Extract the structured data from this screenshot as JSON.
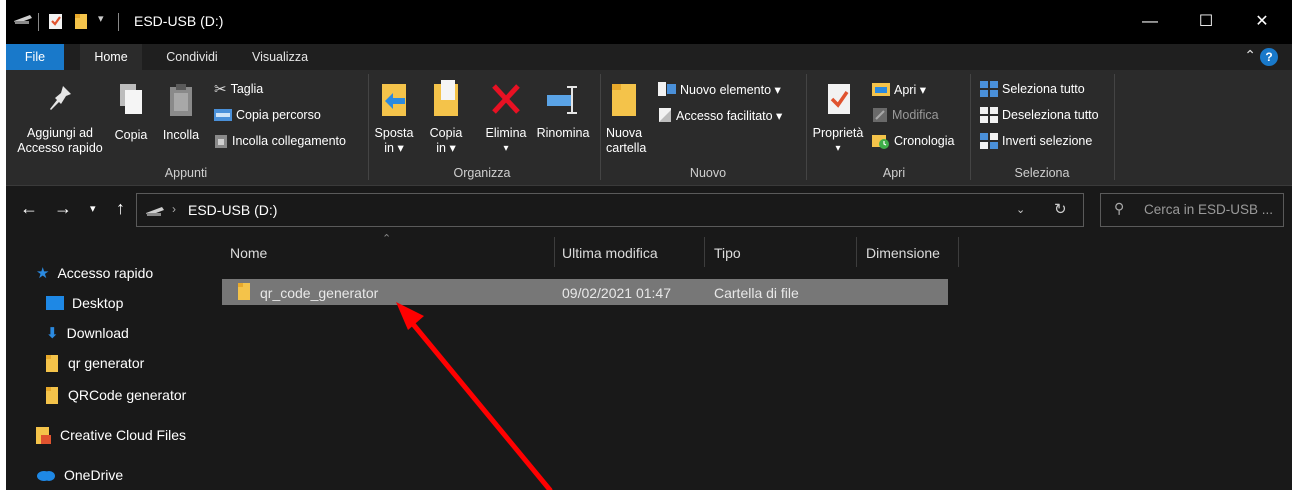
{
  "window": {
    "title": "ESD-USB (D:)",
    "controls": {
      "minimize": "—",
      "maximize": "☐",
      "close": "✕"
    }
  },
  "tabs": [
    {
      "label": "File"
    },
    {
      "label": "Home"
    },
    {
      "label": "Condividi"
    },
    {
      "label": "Visualizza"
    }
  ],
  "ribbon": {
    "appunti": {
      "label": "Appunti",
      "pin_label_1": "Aggiungi ad",
      "pin_label_2": "Accesso rapido",
      "copy": "Copia",
      "paste": "Incolla",
      "cut": "Taglia",
      "copy_path": "Copia percorso",
      "paste_shortcut": "Incolla collegamento"
    },
    "organizza": {
      "label": "Organizza",
      "move_1": "Sposta",
      "move_2": "in ▾",
      "copy_1": "Copia",
      "copy_2": "in ▾",
      "delete": "Elimina",
      "delete_2": "▾",
      "rename": "Rinomina"
    },
    "nuovo": {
      "label": "Nuovo",
      "new_folder_1": "Nuova",
      "new_folder_2": "cartella",
      "new_item": "Nuovo elemento ▾",
      "easy_access": "Accesso facilitato ▾"
    },
    "apri": {
      "label": "Apri",
      "properties": "Proprietà",
      "properties_2": "▾",
      "open": "Apri ▾",
      "edit": "Modifica",
      "history": "Cronologia"
    },
    "seleziona": {
      "label": "Seleziona",
      "select_all": "Seleziona tutto",
      "select_none": "Deseleziona tutto",
      "invert": "Inverti selezione"
    }
  },
  "address": {
    "path": "ESD-USB (D:)",
    "search_placeholder": "Cerca in ESD-USB ..."
  },
  "sidebar": {
    "items": [
      {
        "label": "Accesso rapido"
      },
      {
        "label": "Desktop"
      },
      {
        "label": "Download"
      },
      {
        "label": "qr generator"
      },
      {
        "label": "QRCode generator"
      },
      {
        "label": "Creative Cloud Files"
      },
      {
        "label": "OneDrive"
      }
    ]
  },
  "table": {
    "columns": [
      "Nome",
      "Ultima modifica",
      "Tipo",
      "Dimensione"
    ],
    "rows": [
      {
        "name": "qr_code_generator",
        "modified": "09/02/2021 01:47",
        "type": "Cartella di file",
        "size": ""
      }
    ]
  },
  "colors": {
    "accent": "#1979ca",
    "folder": "#f4c34a",
    "annotation_arrow": "#ff0000"
  }
}
